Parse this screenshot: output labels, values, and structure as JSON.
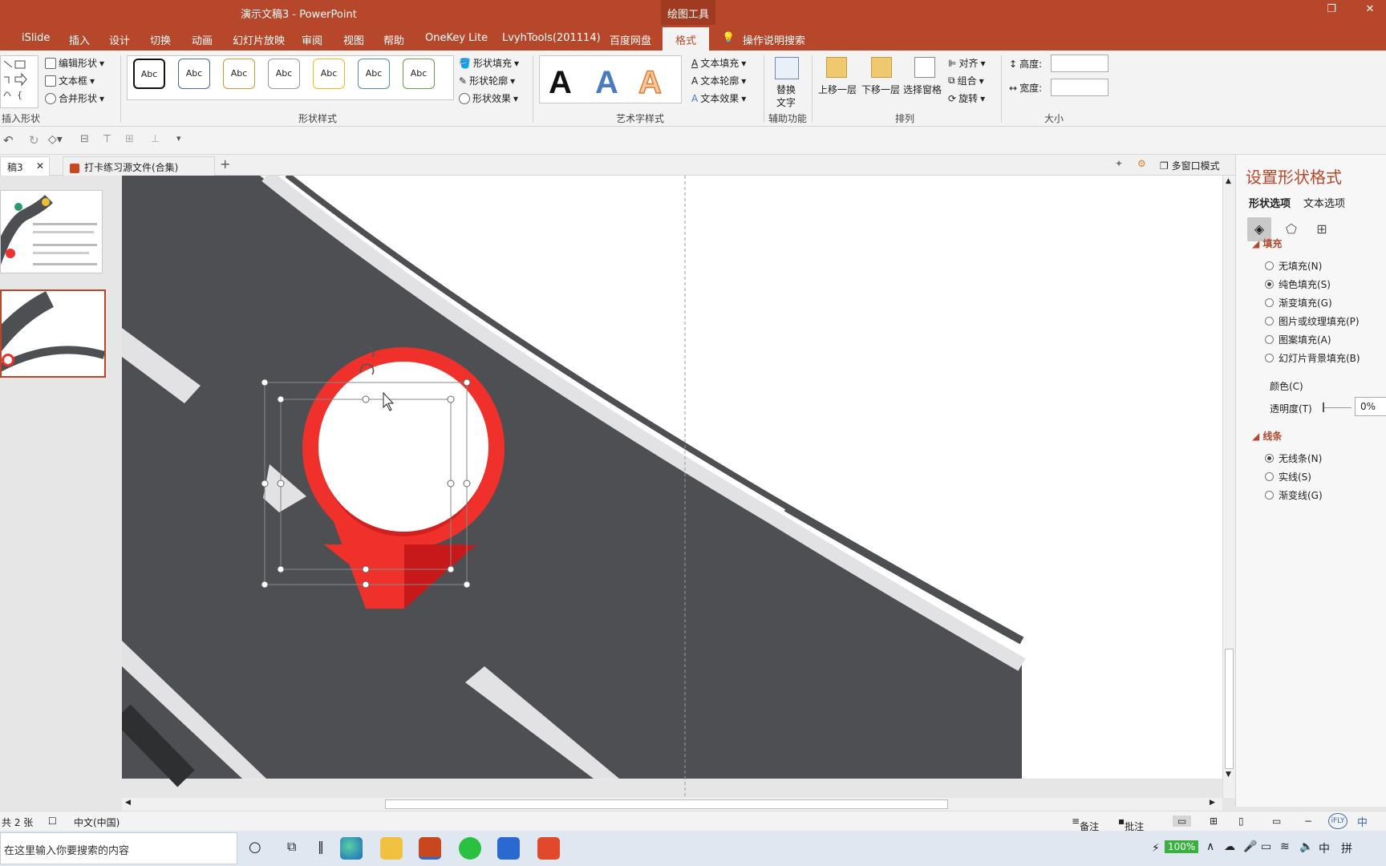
{
  "titlebar": {
    "title": "演示文稿3  -  PowerPoint",
    "context_tab": "绘图工具"
  },
  "tabs": [
    "iSlide",
    "插入",
    "设计",
    "切换",
    "动画",
    "幻灯片放映",
    "审阅",
    "视图",
    "帮助",
    "OneKey Lite",
    "LvyhTools(201114)",
    "百度网盘",
    "格式"
  ],
  "tell_me": "操作说明搜索",
  "ribbon": {
    "insert_shapes": {
      "edit_shape": "编辑形状",
      "textbox": "文本框",
      "merge_shapes": "合并形状",
      "label": "插入形状"
    },
    "shape_styles": {
      "sample": "Abc",
      "fill": "形状填充",
      "outline": "形状轮廓",
      "effects": "形状效果",
      "label": "形状样式"
    },
    "wordart": {
      "sample": "A",
      "text_fill": "文本填充",
      "text_outline": "文本轮廓",
      "text_effects": "文本效果",
      "label": "艺术字样式"
    },
    "accessibility": {
      "alt_text_line1": "替换",
      "alt_text_line2": "文字",
      "label": "辅助功能"
    },
    "arrange": {
      "bring_forward": "上移一层",
      "send_backward": "下移一层",
      "selection_pane": "选择窗格",
      "align": "对齐",
      "group": "组合",
      "rotate": "旋转",
      "label": "排列"
    },
    "size": {
      "height": "高度:",
      "width": "宽度:",
      "label": "大小"
    }
  },
  "doctabs": {
    "current": "稿3",
    "other": "打卡练习源文件(合集)",
    "multiwindow": "多窗口模式"
  },
  "format_pane": {
    "title": "设置形状格式",
    "tab_shape": "形状选项",
    "tab_text": "文本选项",
    "fill_heading": "填充",
    "fill_options": [
      {
        "label": "无填充(N)",
        "selected": false
      },
      {
        "label": "纯色填充(S)",
        "selected": true
      },
      {
        "label": "渐变填充(G)",
        "selected": false
      },
      {
        "label": "图片或纹理填充(P)",
        "selected": false
      },
      {
        "label": "图案填充(A)",
        "selected": false
      },
      {
        "label": "幻灯片背景填充(B)",
        "selected": false
      }
    ],
    "color_label": "颜色(C)",
    "transparency_label": "透明度(T)",
    "transparency_value": "0%",
    "line_heading": "线条",
    "line_options": [
      {
        "label": "无线条(N)",
        "selected": true
      },
      {
        "label": "实线(S)",
        "selected": false
      },
      {
        "label": "渐变线(G)",
        "selected": false
      }
    ]
  },
  "status": {
    "slides": "共 2 张",
    "language": "中文(中国)",
    "notes": "备注",
    "comments": "批注"
  },
  "taskbar": {
    "search_placeholder": "在这里输入你要搜索的内容",
    "battery": "100%",
    "ime": "中",
    "ime2": "拼",
    "ime_badge": "中"
  },
  "colors": {
    "accent": "#b7472a",
    "road": "#4e4f52",
    "pin_red": "#f0302a",
    "pin_dark": "#c8191a"
  }
}
